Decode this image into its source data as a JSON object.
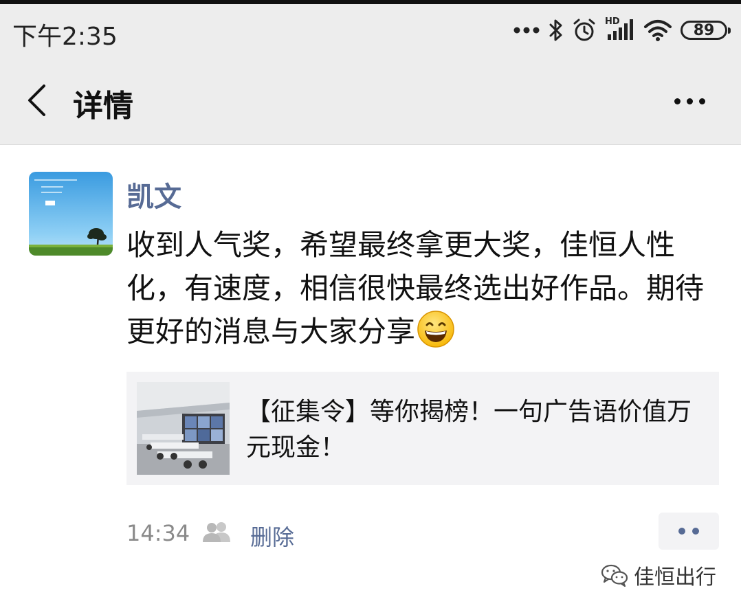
{
  "status_bar": {
    "time": "下午2:35",
    "signal_label": "HD",
    "battery_level": "89",
    "icons": [
      "more-dots-icon",
      "bluetooth-icon",
      "alarm-icon",
      "hd-signal-icon",
      "wifi-icon",
      "battery-icon"
    ]
  },
  "nav": {
    "title": "详情",
    "back_icon": "chevron-left-icon",
    "more_icon": "more-dots-icon"
  },
  "post": {
    "author": "凯文",
    "text": "收到人气奖，希望最终拿更大奖，佳恒人性化，有速度，相信很快最终选出好作品。期待更好的消息与大家分享",
    "emoji_icon": "grinning-face-icon",
    "link": {
      "title": "【征集令】等你揭榜！一句广告语价值万元现金！"
    },
    "time": "14:34",
    "privacy_icon": "friends-visibility-icon",
    "delete_label": "删除",
    "action_icon": "comment-like-dots-icon"
  },
  "watermark": {
    "text": "佳恒出行",
    "icon": "wechat-icon"
  },
  "colors": {
    "link_blue": "#576b95",
    "header_bg": "#ededed",
    "card_bg": "#f3f3f5"
  }
}
